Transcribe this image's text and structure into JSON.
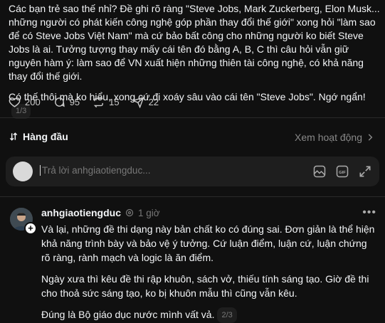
{
  "post": {
    "para1": "Các bạn trẻ sao thế nhỉ? Đề ghi rõ ràng \"Steve Jobs, Mark Zuckerberg, Elon Musk... những người có phát kiến công nghệ góp phần thay đổi thế giới\" xong hỏi \"làm sao để có Steve Jobs Việt Nam\" mà cứ bảo bất công cho những người ko biết Steve Jobs là ai. Tưởng tượng thay mấy cái tên đó bằng A, B, C thì câu hỏi vẫn giữ nguyên hàm ý: làm sao để VN xuất hiện những thiên tài công nghệ, có khả năng thay đổi thế giới.",
    "para2": "Có thế thôi mà ko hiểu, xong cứ đi xoáy sâu vào cái tên \"Steve Jobs\". Ngớ ngẩn!",
    "pager": "1/3"
  },
  "actions": {
    "likes": "200",
    "comments": "95",
    "reposts": "15",
    "shares": "22"
  },
  "sort": {
    "label": "Hàng đầu",
    "view_activity": "Xem hoạt động"
  },
  "reply": {
    "placeholder": "Trả lời anhgiaotiengduc..."
  },
  "comment": {
    "username": "anhgiaotiengduc",
    "time": "1 giờ",
    "p1": "Và lại, những đề thi dạng này bản chất ko có đúng sai. Đơn giản là thể hiện khả năng trình bày và bảo vệ ý tưởng. Cứ luận điểm, luận cứ, luận chứng rõ ràng, rành mạch và logic là ăn điểm.",
    "p2": "Ngày xưa thì kêu đề thi rập khuôn, sách vở, thiếu tính sáng tạo. Giờ đề thi cho thoả sức sáng tạo, ko bị khuôn mẫu thì cũng vẫn kêu.",
    "p3": "Đúng là Bộ giáo dục nước mình vất vả.",
    "pager": "2/3"
  },
  "colors": {
    "background": "#101010",
    "text": "#f3f5f7",
    "muted": "#777777"
  }
}
